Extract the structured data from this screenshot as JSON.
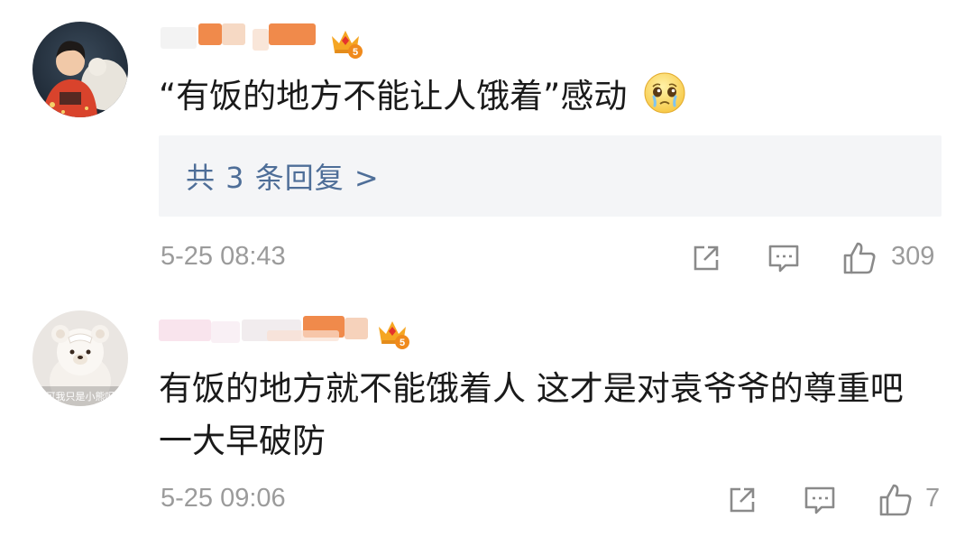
{
  "comments": [
    {
      "username": "",
      "level_badge": "5",
      "text": "“有饭的地方不能让人饿着”感动",
      "emoji": "crying-face-emoji",
      "reply_link": "共 3 条回复 >",
      "timestamp": "5-25 08:43",
      "like_count": "309"
    },
    {
      "username": "",
      "avatar_caption": "可我只是小熊呀",
      "level_badge": "5",
      "text_line1": "有饭的地方就不能饿着人 这才是对袁爷爷的尊重吧",
      "text_line2": "一大早破防",
      "timestamp": "5-25 09:06",
      "like_count": "7"
    }
  ],
  "colors": {
    "text": "#1a1a1a",
    "meta": "#9b9b9b",
    "reply_link": "#4e6e98",
    "reply_bg": "#f4f5f7",
    "blur_orange": "#f08a4b",
    "crown_orange": "#f5a623"
  }
}
